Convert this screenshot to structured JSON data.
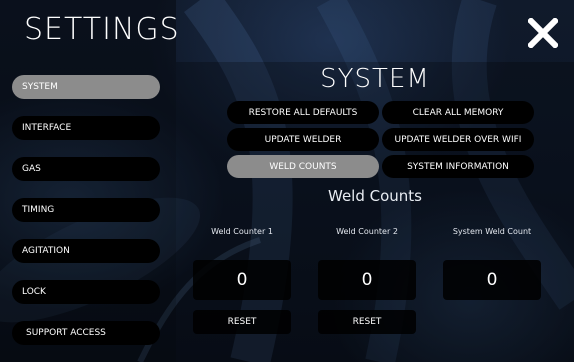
{
  "header": {
    "title": "SETTINGS",
    "close_icon": "close-icon"
  },
  "sidebar": {
    "items": [
      {
        "label": "SYSTEM",
        "active": true
      },
      {
        "label": "INTERFACE",
        "active": false
      },
      {
        "label": "GAS",
        "active": false
      },
      {
        "label": "TIMING",
        "active": false
      },
      {
        "label": "AGITATION",
        "active": false
      },
      {
        "label": "LOCK",
        "active": false
      },
      {
        "label": "SUPPORT ACCESS",
        "active": false
      }
    ]
  },
  "main": {
    "section_title": "SYSTEM",
    "buttons": [
      {
        "label": "RESTORE ALL DEFAULTS",
        "active": false
      },
      {
        "label": "CLEAR ALL MEMORY",
        "active": false
      },
      {
        "label": "UPDATE WELDER",
        "active": false
      },
      {
        "label": "UPDATE WELDER OVER WIFI",
        "active": false
      },
      {
        "label": "WELD COUNTS",
        "active": true
      },
      {
        "label": "SYSTEM INFORMATION",
        "active": false
      }
    ],
    "subheading": "Weld Counts",
    "counters": [
      {
        "label": "Weld Counter 1",
        "value": "0",
        "reset_label": "RESET"
      },
      {
        "label": "Weld Counter 2",
        "value": "0",
        "reset_label": "RESET"
      },
      {
        "label": "System Weld Count",
        "value": "0"
      }
    ]
  },
  "colors": {
    "active": "#8c8c8c",
    "inactive": "#000000",
    "background": "#0d1626"
  }
}
